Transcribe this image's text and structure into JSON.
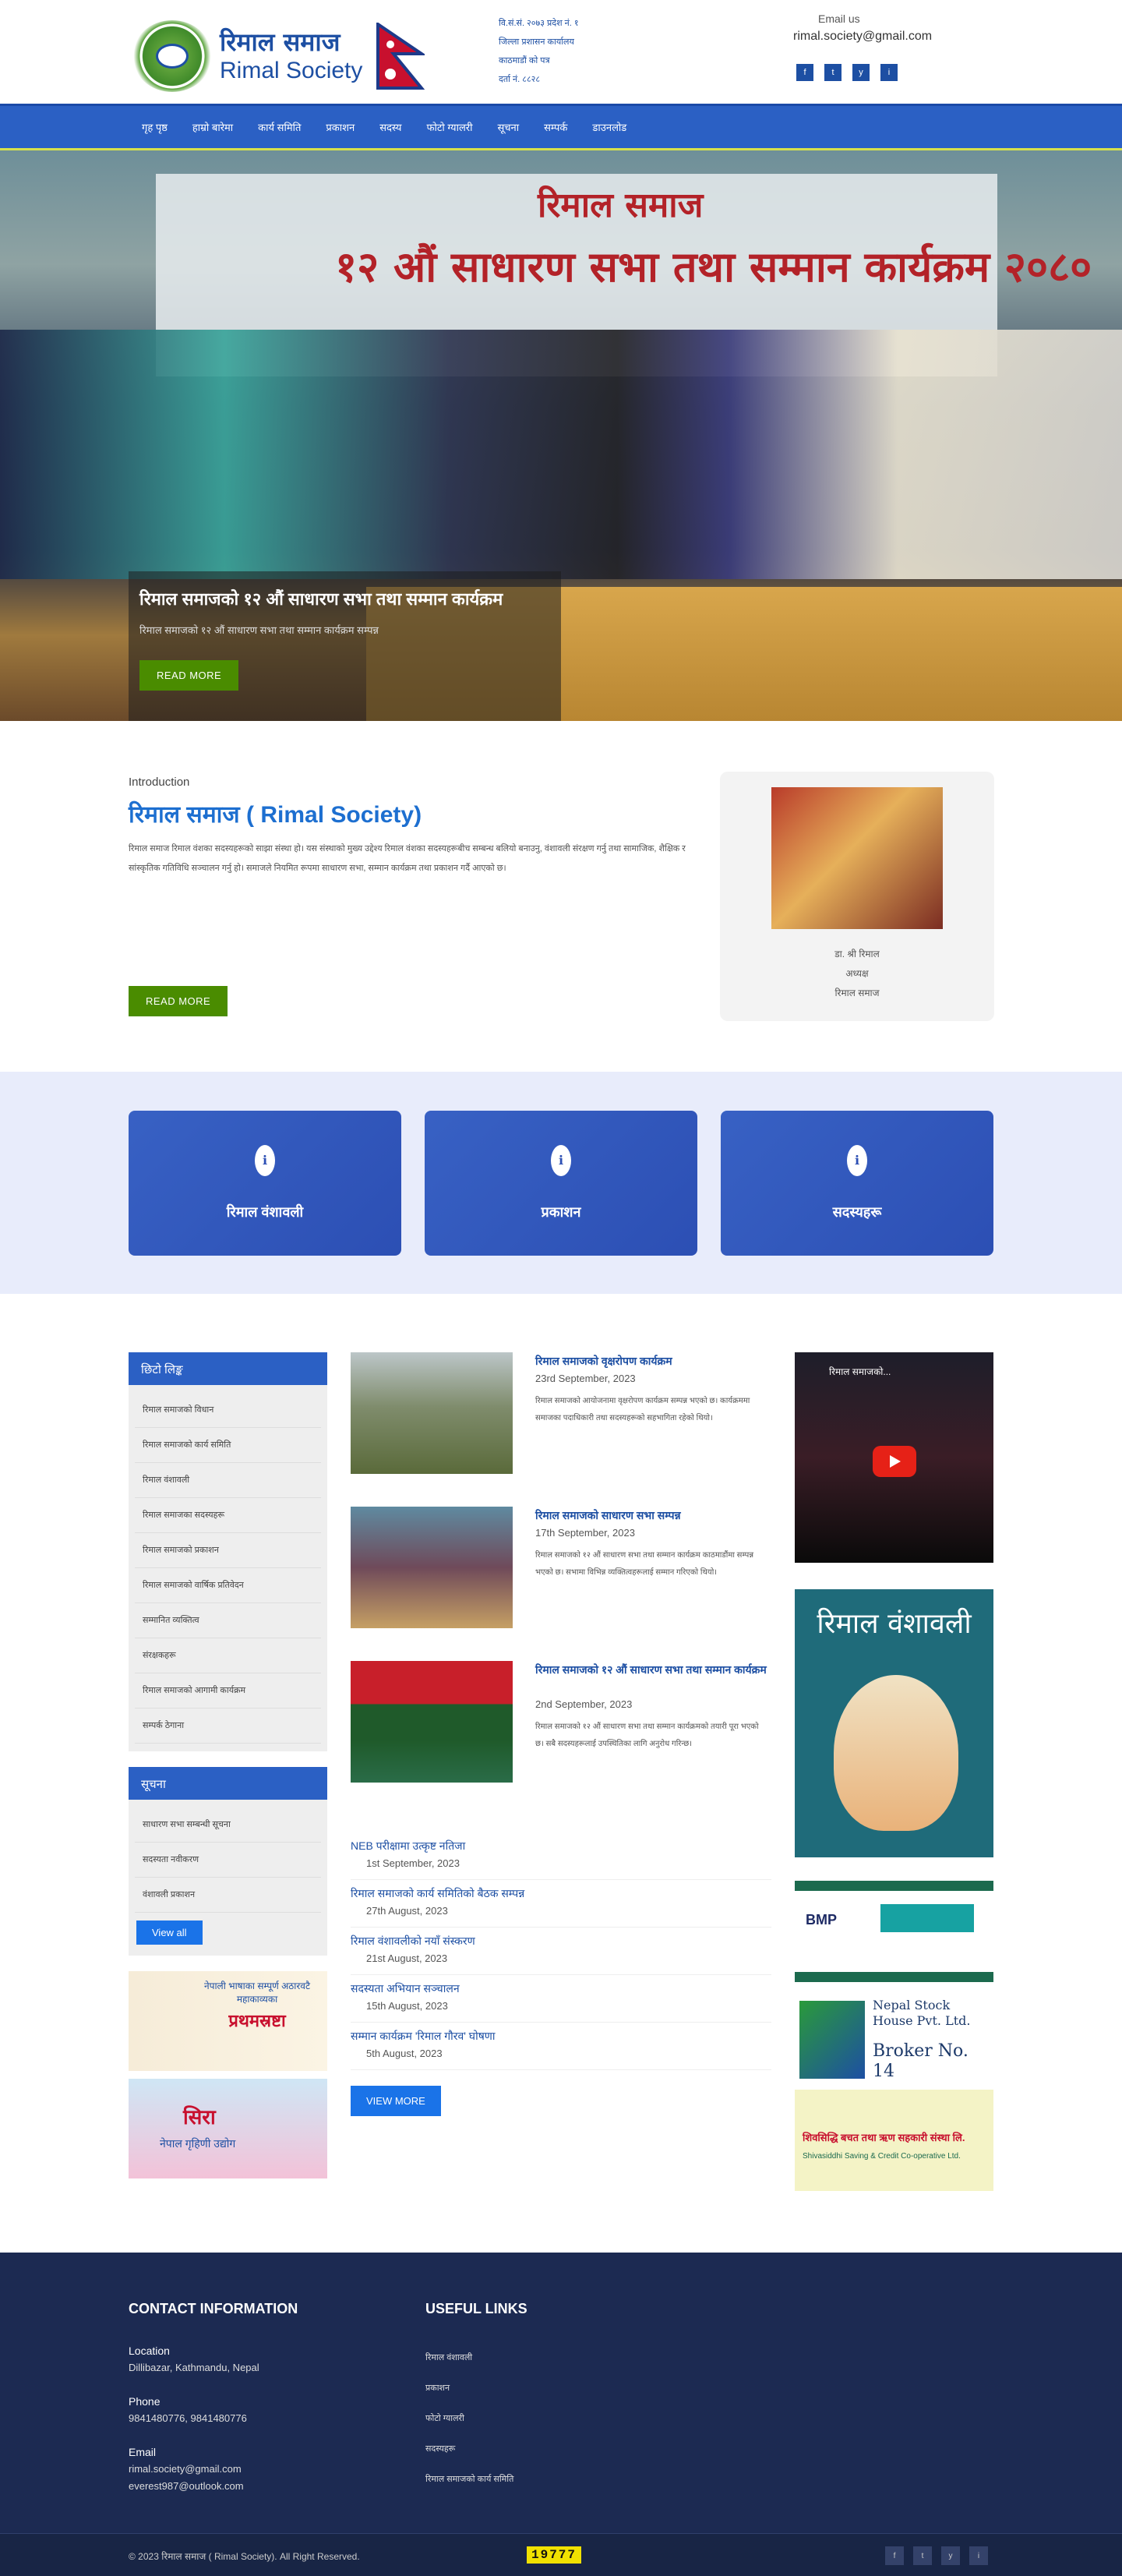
{
  "header": {
    "logo_np": "रिमाल समाज",
    "logo_en": "Rimal Society",
    "address_lines": [
      "वि.सं.सं. २०७३ प्रदेश नं. १",
      "जिल्ला प्रशासन कार्यालय",
      "काठमाडौं को पत्र",
      "दर्ता नं. ८८२८"
    ],
    "email_label": "Email us",
    "email": "rimal.society@gmail.com",
    "social": [
      "f",
      "t",
      "y",
      "i"
    ]
  },
  "nav": [
    "गृह पृष्ठ",
    "हाम्रो बारेमा",
    "कार्य समिति",
    "प्रकाशन",
    "सदस्य",
    "फोटो ग्यालरी",
    "सूचना",
    "सम्पर्क",
    "डाउनलोड"
  ],
  "hero": {
    "title": "रिमाल समाजको १२ औं साधारण सभा तथा सम्मान कार्यक्रम",
    "subtitle": "रिमाल समाजको १२ औं साधारण सभा तथा सम्मान कार्यक्रम सम्पन्न",
    "button": "READ MORE",
    "banner_top": "रिमाल समाज",
    "banner_main": "१२ औं साधारण सभा तथा सम्मान कार्यक्रम २०८०"
  },
  "intro": {
    "label": "Introduction",
    "title": "रिमाल समाज ( Rimal Society)",
    "body": "रिमाल समाज रिमाल वंशका सदस्यहरूको साझा संस्था हो। यस संस्थाको मुख्य उद्देश्य रिमाल वंशका सदस्यहरूबीच सम्बन्ध बलियो बनाउनु, वंशावली संरक्षण गर्नु तथा सामाजिक, शैक्षिक र सांस्कृतिक गतिविधि सञ्चालन गर्नु हो। समाजले नियमित रूपमा साधारण सभा, सम्मान कार्यक्रम तथा प्रकाशन गर्दै आएको छ।",
    "button": "READ MORE",
    "card_caption": [
      "डा. श्री रिमाल",
      "अध्यक्ष",
      "रिमाल समाज"
    ]
  },
  "features": [
    {
      "title": "रिमाल वंशावली",
      "icon": "info-icon"
    },
    {
      "title": "प्रकाशन",
      "icon": "info-icon"
    },
    {
      "title": "सदस्यहरू",
      "icon": "info-icon"
    }
  ],
  "sidebar": {
    "links_title": "छिटो लिङ्क",
    "links": [
      "रिमाल समाजको विधान",
      "रिमाल समाजको कार्य समिति",
      "रिमाल वंशावली",
      "रिमाल समाजका सदस्यहरू",
      "रिमाल समाजको प्रकाशन",
      "रिमाल समाजको वार्षिक प्रतिवेदन",
      "सम्मानित व्यक्तित्व",
      "संरक्षकहरू",
      "रिमाल समाजको आगामी कार्यक्रम",
      "सम्पर्क ठेगाना"
    ],
    "notice_title": "सूचना",
    "notices": [
      "साधारण सभा सम्बन्धी सूचना",
      "सदस्यता नवीकरण",
      "वंशावली प्रकाशन"
    ],
    "view_all": "View all",
    "ad1_title": "प्रथमस्रष्टा",
    "ad1_sub": "नेपाली भाषाका सम्पूर्ण अठारवटै महाकाव्यका",
    "ad2_title": "सिरा",
    "ad2_sub": "नेपाल गृहिणी उद्योग"
  },
  "posts": [
    {
      "title": "रिमाल समाजको वृक्षरोपण कार्यक्रम",
      "date": "23rd September, 2023",
      "excerpt": "रिमाल समाजको आयोजनामा वृक्षरोपण कार्यक्रम सम्पन्न भएको छ। कार्यक्रममा समाजका पदाधिकारी तथा सदस्यहरूको सहभागिता रहेको थियो।"
    },
    {
      "title": "रिमाल समाजको साधारण सभा सम्पन्न",
      "date": "17th September, 2023",
      "excerpt": "रिमाल समाजको १२ औं साधारण सभा तथा सम्मान कार्यक्रम काठमाडौंमा सम्पन्न भएको छ। सभामा विभिन्न व्यक्तित्वहरूलाई सम्मान गरिएको थियो।"
    },
    {
      "title": "रिमाल समाजको १२ औं साधारण सभा तथा सम्मान कार्यक्रम",
      "date": "2nd September, 2023",
      "excerpt": "रिमाल समाजको १२ औं साधारण सभा तथा सम्मान कार्यक्रमको तयारी पूरा भएको छ। सबै सदस्यहरूलाई उपस्थितिका लागि अनुरोध गरिन्छ।"
    }
  ],
  "news": [
    {
      "title": "NEB परीक्षामा उत्कृष्ट नतिजा",
      "date": "1st September, 2023"
    },
    {
      "title": "रिमाल समाजको कार्य समितिको बैठक सम्पन्न",
      "date": "27th August, 2023"
    },
    {
      "title": "रिमाल वंशावलीको नयाँ संस्करण",
      "date": "21st August, 2023"
    },
    {
      "title": "सदस्यता अभियान सञ्चालन",
      "date": "15th August, 2023"
    },
    {
      "title": "सम्मान कार्यक्रम 'रिमाल गौरव' घोषणा",
      "date": "5th August, 2023"
    }
  ],
  "view_more": "VIEW MORE",
  "right": {
    "video_title": "रिमाल समाजको...",
    "book_title": "रिमाल वंशावली",
    "ad3_title": "BMP",
    "ad4_title": "Nepal Stock House Pvt. Ltd.",
    "ad4_sub": "Broker No. 14",
    "ad5_title": "शिवसिद्धि बचत तथा ऋण सहकारी संस्था लि.",
    "ad5_sub": "Shivasiddhi Saving & Credit Co-operative Ltd."
  },
  "footer": {
    "contact_title": "CONTACT INFORMATION",
    "location_label": "Location",
    "location": "Dillibazar, Kathmandu, Nepal",
    "phone_label": "Phone",
    "phone": "9841480776, 9841480776",
    "email_label": "Email",
    "email1": "rimal.society@gmail.com",
    "email2": "everest987@outlook.com",
    "links_title": "USEFUL LINKS",
    "links": [
      "रिमाल वंशावली",
      "प्रकाशन",
      "फोटो ग्यालरी",
      "सदस्यहरू",
      "रिमाल समाजको कार्य समिति"
    ],
    "copyright": "© 2023 रिमाल समाज ( Rimal Society). All Right Reserved.",
    "counter": "19777",
    "social": [
      "f",
      "t",
      "y",
      "i"
    ]
  },
  "colors": {
    "primary": "#2b60c4",
    "accent_green": "#4a8c00",
    "footer": "#1c2a52",
    "link": "#1d4fa3"
  }
}
